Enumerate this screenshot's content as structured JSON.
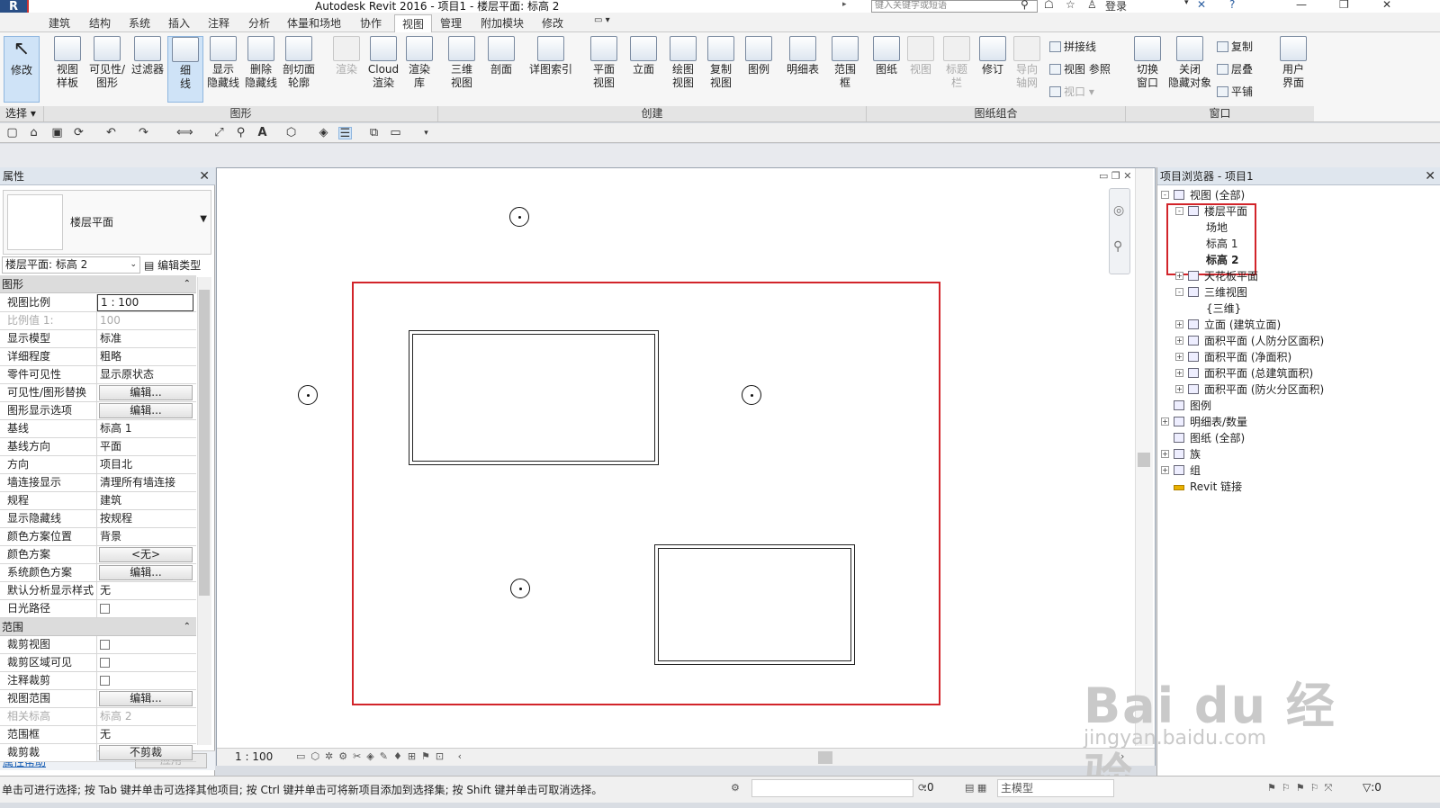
{
  "titlebar": {
    "app_menu": "R",
    "title": "Autodesk Revit 2016 -     项目1 - 楼层平面: 标高 2",
    "search_placeholder": "键入关键字或短语",
    "login": "登录"
  },
  "tabs": [
    "建筑",
    "结构",
    "系统",
    "插入",
    "注释",
    "分析",
    "体量和场地",
    "协作",
    "视图",
    "管理",
    "附加模块",
    "修改"
  ],
  "active_tab": "视图",
  "ribbon": {
    "modify": "修改",
    "graphics_buttons": [
      {
        "label": "视图\n样板"
      },
      {
        "label": "可见性/\n图形"
      },
      {
        "label": "过滤器"
      },
      {
        "label": "细\n线"
      },
      {
        "label": "显示\n隐藏线"
      },
      {
        "label": "删除\n隐藏线"
      },
      {
        "label": "剖切面\n轮廓"
      }
    ],
    "render_buttons": [
      {
        "label": "渲染"
      },
      {
        "label": "Cloud\n渲染"
      },
      {
        "label": "渲染\n库"
      }
    ],
    "create_buttons": [
      {
        "label": "三维\n视图"
      },
      {
        "label": "剖面"
      },
      {
        "label": "详图索引"
      },
      {
        "label": "平面\n视图"
      },
      {
        "label": "立面"
      },
      {
        "label": "绘图\n视图"
      },
      {
        "label": "复制\n视图"
      },
      {
        "label": "图例"
      },
      {
        "label": "明细表"
      },
      {
        "label": "范围\n框"
      }
    ],
    "sheet_buttons": [
      {
        "label": "图纸"
      },
      {
        "label": "视图"
      },
      {
        "label": "标题\n栏"
      },
      {
        "label": "修订"
      },
      {
        "label": "导向\n轴网"
      }
    ],
    "sheet_small": [
      "拼接线",
      "视图 参照",
      "视口"
    ],
    "window_buttons": [
      {
        "label": "切换\n窗口"
      },
      {
        "label": "关闭\n隐藏对象"
      }
    ],
    "window_small": [
      "复制",
      "层叠",
      "平铺"
    ],
    "ui_button": {
      "label": "用户\n界面"
    },
    "panels": {
      "select": "选择",
      "graphics": "图形",
      "create": "创建",
      "sheet": "图纸组合",
      "window": "窗口"
    }
  },
  "properties": {
    "title": "属性",
    "type_name": "楼层平面",
    "instance": "楼层平面: 标高 2",
    "edit_type": "编辑类型",
    "groups": {
      "graphics": "图形",
      "extents": "范围"
    },
    "rows": [
      {
        "label": "视图比例",
        "value": "1 : 100",
        "kind": "input"
      },
      {
        "label": "比例值 1:",
        "value": "100",
        "kind": "dim"
      },
      {
        "label": "显示模型",
        "value": "标准"
      },
      {
        "label": "详细程度",
        "value": "粗略"
      },
      {
        "label": "零件可见性",
        "value": "显示原状态"
      },
      {
        "label": "可见性/图形替换",
        "value": "编辑...",
        "kind": "button"
      },
      {
        "label": "图形显示选项",
        "value": "编辑...",
        "kind": "button"
      },
      {
        "label": "基线",
        "value": "标高 1"
      },
      {
        "label": "基线方向",
        "value": "平面"
      },
      {
        "label": "方向",
        "value": "项目北"
      },
      {
        "label": "墙连接显示",
        "value": "清理所有墙连接"
      },
      {
        "label": "规程",
        "value": "建筑"
      },
      {
        "label": "显示隐藏线",
        "value": "按规程"
      },
      {
        "label": "颜色方案位置",
        "value": "背景"
      },
      {
        "label": "颜色方案",
        "value": "<无>",
        "kind": "button"
      },
      {
        "label": "系统颜色方案",
        "value": "编辑...",
        "kind": "button"
      },
      {
        "label": "默认分析显示样式",
        "value": "无"
      },
      {
        "label": "日光路径",
        "value": "",
        "kind": "check"
      }
    ],
    "extent_rows": [
      {
        "label": "裁剪视图",
        "value": "",
        "kind": "check"
      },
      {
        "label": "裁剪区域可见",
        "value": "",
        "kind": "check"
      },
      {
        "label": "注释裁剪",
        "value": "",
        "kind": "check"
      },
      {
        "label": "视图范围",
        "value": "编辑...",
        "kind": "button"
      },
      {
        "label": "相关标高",
        "value": "标高 2",
        "kind": "dim"
      },
      {
        "label": "范围框",
        "value": "无"
      },
      {
        "label": "裁剪裁",
        "value": "不剪裁",
        "kind": "button"
      }
    ],
    "help": "属性帮助",
    "apply": "应用"
  },
  "view": {
    "scale": "1 : 100"
  },
  "browser": {
    "title": "项目浏览器 - 项目1",
    "items": [
      {
        "label": "视图 (全部)",
        "level": 0,
        "exp": "-"
      },
      {
        "label": "楼层平面",
        "level": 1,
        "exp": "-"
      },
      {
        "label": "场地",
        "level": 2
      },
      {
        "label": "标高 1",
        "level": 2
      },
      {
        "label": "标高 2",
        "level": 2,
        "bold": true
      },
      {
        "label": "天花板平面",
        "level": 1,
        "exp": "+"
      },
      {
        "label": "三维视图",
        "level": 1,
        "exp": "-"
      },
      {
        "label": "{三维}",
        "level": 2
      },
      {
        "label": "立面 (建筑立面)",
        "level": 1,
        "exp": "+"
      },
      {
        "label": "面积平面 (人防分区面积)",
        "level": 1,
        "exp": "+"
      },
      {
        "label": "面积平面 (净面积)",
        "level": 1,
        "exp": "+"
      },
      {
        "label": "面积平面 (总建筑面积)",
        "level": 1,
        "exp": "+"
      },
      {
        "label": "面积平面 (防火分区面积)",
        "level": 1,
        "exp": "+"
      },
      {
        "label": "图例",
        "level": 0
      },
      {
        "label": "明细表/数量",
        "level": 0,
        "exp": "+"
      },
      {
        "label": "图纸 (全部)",
        "level": 0
      },
      {
        "label": "族",
        "level": 0,
        "exp": "+"
      },
      {
        "label": "组",
        "level": 0,
        "exp": "+"
      },
      {
        "label": "Revit 链接",
        "level": 0,
        "link": true
      }
    ]
  },
  "watermark": {
    "main": "Bai du 经验",
    "sub": "jingyan.baidu.com"
  },
  "status": {
    "text": "单击可进行选择; 按 Tab 键并单击可选择其他项目; 按 Ctrl 键并单击可将新项目添加到选择集; 按 Shift 键并单击可取消选择。",
    "count": ":0",
    "model": "主模型",
    "filter": ":0"
  }
}
